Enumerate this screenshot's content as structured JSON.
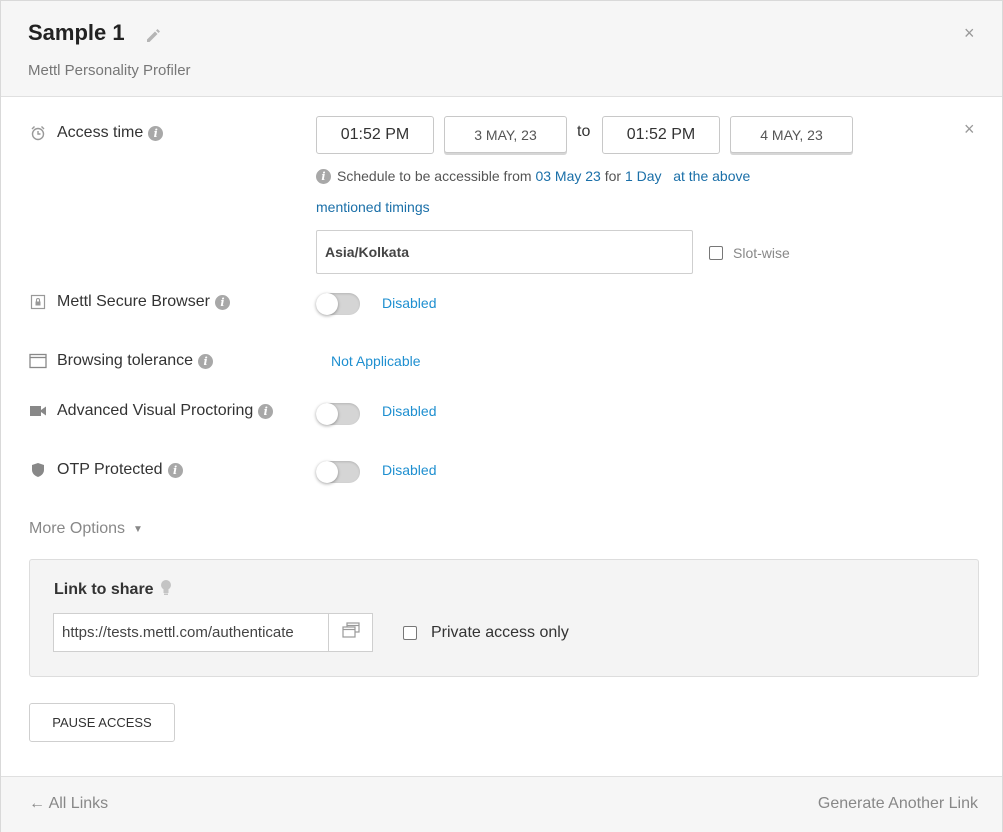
{
  "header": {
    "title": "Sample 1",
    "subtitle": "Mettl Personality Profiler",
    "edit_icon": "pencil-icon",
    "close_icon": "close-icon",
    "close_symbol": "×"
  },
  "access_time": {
    "label": "Access time",
    "icon": "alarm-clock-icon",
    "start_time": "01:52 PM",
    "start_date": "3 MAY, 23",
    "to_label": "to",
    "end_time": "01:52 PM",
    "end_date": "4 MAY, 23",
    "remove_symbol": "×",
    "schedule_prefix": "Schedule to be accessible from",
    "schedule_date": "03 May 23",
    "schedule_for": "for",
    "schedule_duration": "1 Day",
    "schedule_suffix_1": "at the above",
    "schedule_suffix_2": "mentioned timings",
    "timezone": "Asia/Kolkata",
    "slot_wise_label": "Slot-wise"
  },
  "settings": {
    "secure_browser": {
      "label": "Mettl Secure Browser",
      "icon": "lock-window-icon",
      "status": "Disabled"
    },
    "browsing_tolerance": {
      "label": "Browsing tolerance",
      "icon": "browser-window-icon",
      "status": "Not Applicable"
    },
    "visual_proctoring": {
      "label": "Advanced Visual Proctoring",
      "icon": "video-camera-icon",
      "status": "Disabled"
    },
    "otp": {
      "label": "OTP Protected",
      "icon": "shield-icon",
      "status": "Disabled"
    }
  },
  "more_options": {
    "label": "More Options",
    "caret": "▼"
  },
  "share": {
    "title": "Link to share",
    "url": "https://tests.mettl.com/authenticate",
    "private_label": "Private access only"
  },
  "actions": {
    "pause_label": "PAUSE ACCESS"
  },
  "footer": {
    "all_links": "← All Links",
    "generate": "Generate Another Link"
  },
  "colors": {
    "accent": "#1e8fd0",
    "link": "#1a6fa8",
    "header_bg": "#f6f6f6"
  }
}
